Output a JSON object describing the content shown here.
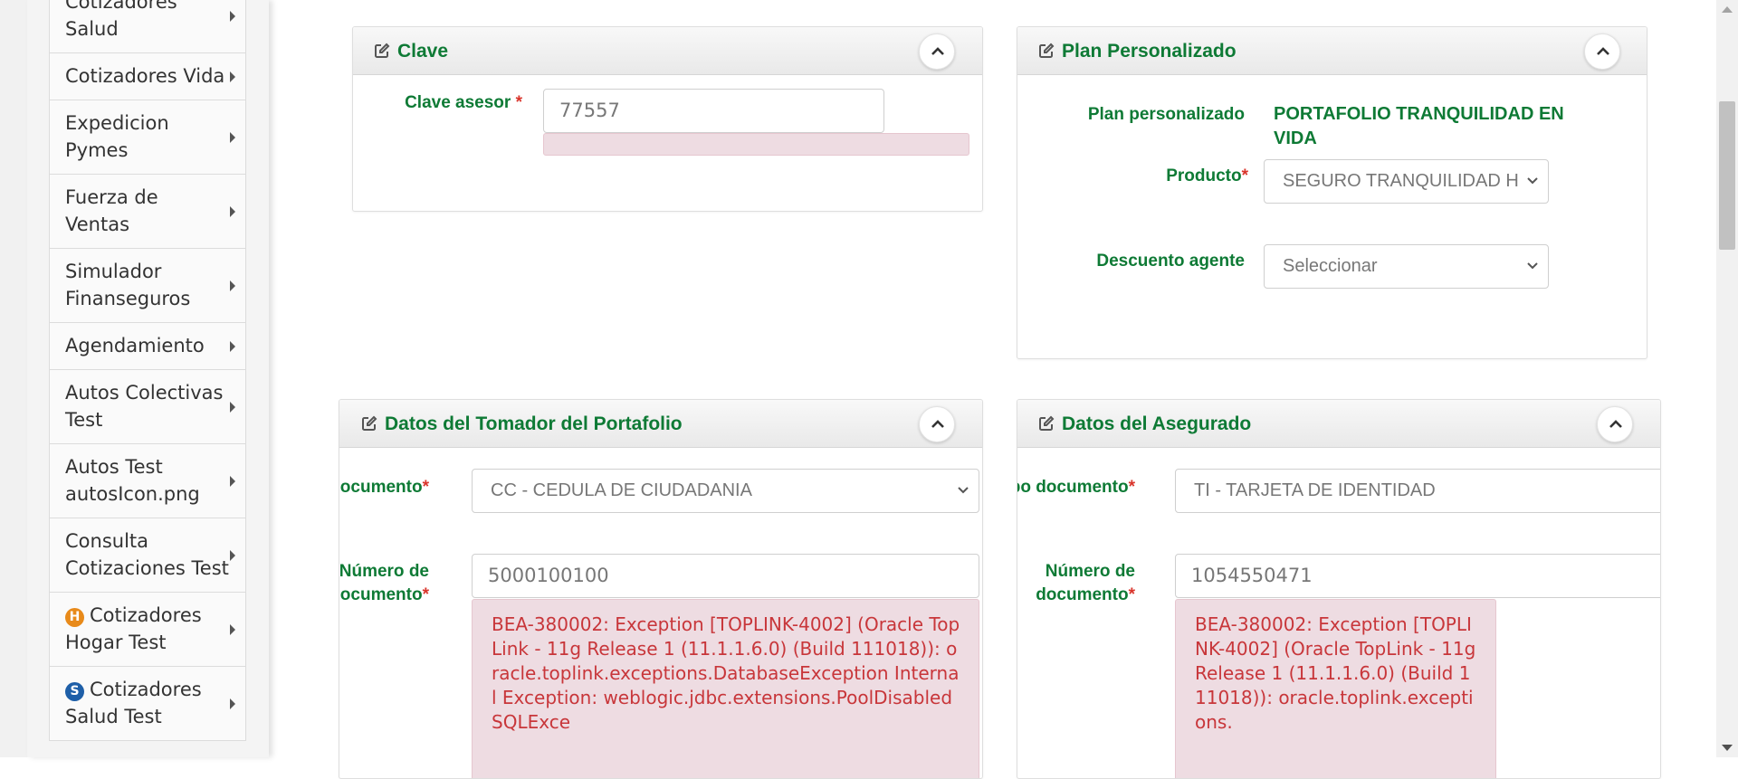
{
  "sidebar": {
    "items": [
      {
        "label": "Cotizadores Salud"
      },
      {
        "label": "Cotizadores Vida"
      },
      {
        "label": "Expedicion Pymes"
      },
      {
        "label": "Fuerza de Ventas"
      },
      {
        "label": "Simulador Finanseguros"
      },
      {
        "label": "Agendamiento"
      },
      {
        "label": "Autos Colectivas Test"
      },
      {
        "label": "Autos Test autosIcon.png"
      },
      {
        "label": "Consulta Cotizaciones Test"
      },
      {
        "label": "Cotizadores Hogar Test",
        "icon": "H",
        "icon_color": "#e88a1a"
      },
      {
        "label": "Cotizadores Salud Test",
        "icon": "S",
        "icon_color": "#1e5fa8"
      }
    ]
  },
  "clave": {
    "title": "Clave",
    "label": "Clave asesor",
    "required": "*",
    "value": "77557"
  },
  "plan": {
    "title": "Plan Personalizado",
    "plan_label": "Plan personalizado",
    "plan_value": "PORTAFOLIO TRANQUILIDAD EN VIDA",
    "producto_label": "Producto",
    "producto_value": "SEGURO TRANQUILIDAD H",
    "descuento_label": "Descuento agente",
    "descuento_value": "Seleccionar",
    "required": "*"
  },
  "tomador": {
    "title": "Datos del Tomador del Portafolio",
    "tipo_label": "o documento",
    "tipo_value": "CC - CEDULA DE CIUDADANIA",
    "numero_label_1": "Número de",
    "numero_label_2": "documento",
    "numero_value": "5000100100",
    "required": "*",
    "error": "BEA-380002: Exception [TOPLINK-4002] (Oracle TopLink - 11g Release 1 (11.1.1.6.0) (Build 111018)): oracle.toplink.exceptions.DatabaseException Internal Exception: weblogic.jdbc.extensions.PoolDisabledSQLExce"
  },
  "asegurado": {
    "title": "Datos del Asegurado",
    "tipo_label": "Tipo documento",
    "tipo_value": "TI - TARJETA DE IDENTIDAD",
    "numero_label_1": "Número de",
    "numero_label_2": "documento",
    "numero_value": "1054550471",
    "required": "*",
    "error": "BEA-380002: Exception [TOPLINK-4002] (Oracle TopLink - 11g Release 1 (11.1.1.6.0) (Build 111018)): oracle.toplink.exceptions."
  },
  "colors": {
    "label_green": "#0e7a35",
    "required_red": "#d9342b",
    "error_bg": "#eedce2",
    "error_text": "#c8363a"
  }
}
